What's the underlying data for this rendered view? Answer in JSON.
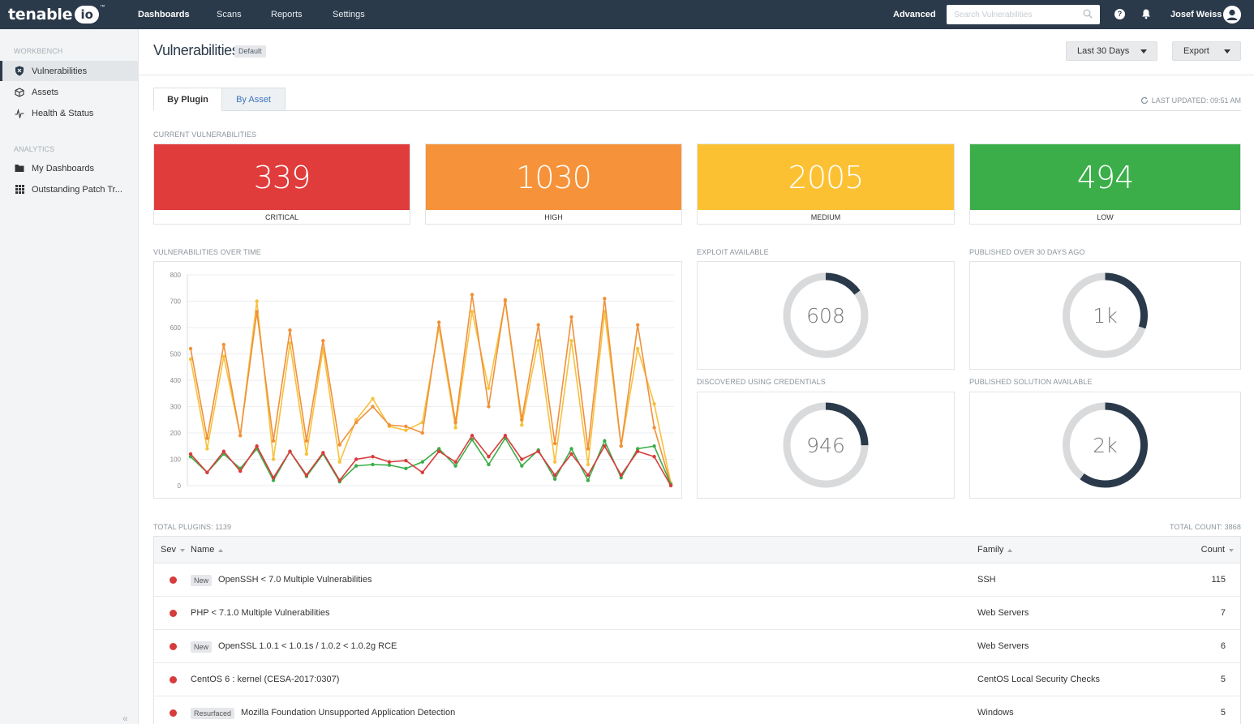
{
  "nav": {
    "logo_word": "tenable",
    "logo_io": "io",
    "logo_tm": "™",
    "items": [
      "Dashboards",
      "Scans",
      "Reports",
      "Settings"
    ],
    "advanced": "Advanced",
    "search_placeholder": "Search Vulnerabilities",
    "help": "?",
    "user": "Josef Weiss"
  },
  "sidebar": {
    "workbench_heading": "WORKBENCH",
    "workbench_items": [
      "Vulnerabilities",
      "Assets",
      "Health & Status"
    ],
    "analytics_heading": "ANALYTICS",
    "analytics_items": [
      "My Dashboards",
      "Outstanding Patch Tr..."
    ],
    "collapse": "«"
  },
  "header": {
    "title": "Vulnerabilities",
    "badge": "Default",
    "range_button": "Last 30 Days",
    "export_button": "Export"
  },
  "tabs": {
    "by_plugin": "By Plugin",
    "by_asset": "By Asset",
    "last_updated": "LAST UPDATED: 09:51 AM"
  },
  "current": {
    "label": "CURRENT VULNERABILITIES",
    "cards": [
      {
        "value": "339",
        "label": "CRITICAL",
        "color": "#e03c3c"
      },
      {
        "value": "1030",
        "label": "HIGH",
        "color": "#f6933a"
      },
      {
        "value": "2005",
        "label": "MEDIUM",
        "color": "#fcc133"
      },
      {
        "value": "494",
        "label": "LOW",
        "color": "#3bae49"
      }
    ]
  },
  "chart_label": "VULNERABILITIES OVER TIME",
  "chart_data": {
    "type": "line",
    "ylim": [
      0,
      800
    ],
    "yticks": [
      "0",
      "100",
      "200",
      "300",
      "400",
      "500",
      "600",
      "700",
      "800"
    ],
    "x": [
      1,
      2,
      3,
      4,
      5,
      6,
      7,
      8,
      9,
      10,
      11,
      12,
      13,
      14,
      15,
      16,
      17,
      18,
      19,
      20,
      21,
      22,
      23,
      24,
      25,
      26,
      27,
      28,
      29,
      30
    ],
    "series": [
      {
        "color": "#f7c13c",
        "values": [
          480,
          140,
          490,
          190,
          700,
          100,
          540,
          120,
          520,
          90,
          250,
          330,
          225,
          210,
          240,
          600,
          220,
          660,
          370,
          700,
          230,
          550,
          90,
          550,
          80,
          660,
          150,
          520,
          310,
          10
        ]
      },
      {
        "color": "#f0903a",
        "values": [
          520,
          180,
          535,
          190,
          660,
          170,
          590,
          170,
          550,
          155,
          240,
          300,
          230,
          225,
          200,
          620,
          240,
          725,
          300,
          705,
          250,
          610,
          160,
          640,
          140,
          710,
          150,
          610,
          220,
          5
        ]
      },
      {
        "color": "#3bae49",
        "values": [
          110,
          50,
          120,
          65,
          140,
          20,
          130,
          35,
          120,
          15,
          75,
          80,
          78,
          65,
          90,
          140,
          75,
          175,
          80,
          180,
          75,
          135,
          25,
          140,
          20,
          170,
          30,
          140,
          150,
          5
        ]
      },
      {
        "color": "#d93c3c",
        "values": [
          120,
          50,
          130,
          55,
          150,
          30,
          130,
          40,
          125,
          20,
          100,
          110,
          90,
          95,
          50,
          130,
          90,
          190,
          110,
          190,
          100,
          130,
          40,
          120,
          40,
          150,
          40,
          130,
          110,
          0
        ]
      }
    ]
  },
  "donuts": [
    {
      "label": "EXPLOIT AVAILABLE",
      "value": "608",
      "fraction": 0.15
    },
    {
      "label": "PUBLISHED OVER 30 DAYS AGO",
      "value": "1k",
      "fraction": 0.3
    },
    {
      "label": "DISCOVERED USING CREDENTIALS",
      "value": "946",
      "fraction": 0.25
    },
    {
      "label": "PUBLISHED SOLUTION AVAILABLE",
      "value": "2k",
      "fraction": 0.6
    }
  ],
  "donut_colors": {
    "track": "#d9dadb",
    "fill": "#2b3a4a"
  },
  "table": {
    "total_plugins": "TOTAL PLUGINS: 1139",
    "total_count": "TOTAL COUNT: 3868",
    "headers": {
      "sev": "Sev",
      "name": "Name",
      "family": "Family",
      "count": "Count"
    },
    "rows": [
      {
        "tag": "New",
        "name": "OpenSSH < 7.0 Multiple Vulnerabilities",
        "family": "SSH",
        "count": "115"
      },
      {
        "tag": "",
        "name": "PHP < 7.1.0 Multiple Vulnerabilities",
        "family": "Web Servers",
        "count": "7"
      },
      {
        "tag": "New",
        "name": "OpenSSL 1.0.1 < 1.0.1s / 1.0.2 < 1.0.2g RCE",
        "family": "Web Servers",
        "count": "6"
      },
      {
        "tag": "",
        "name": "CentOS 6 : kernel (CESA-2017:0307)",
        "family": "CentOS Local Security Checks",
        "count": "5"
      },
      {
        "tag": "Resurfaced",
        "name": "Mozilla Foundation Unsupported Application Detection",
        "family": "Windows",
        "count": "5"
      }
    ]
  }
}
